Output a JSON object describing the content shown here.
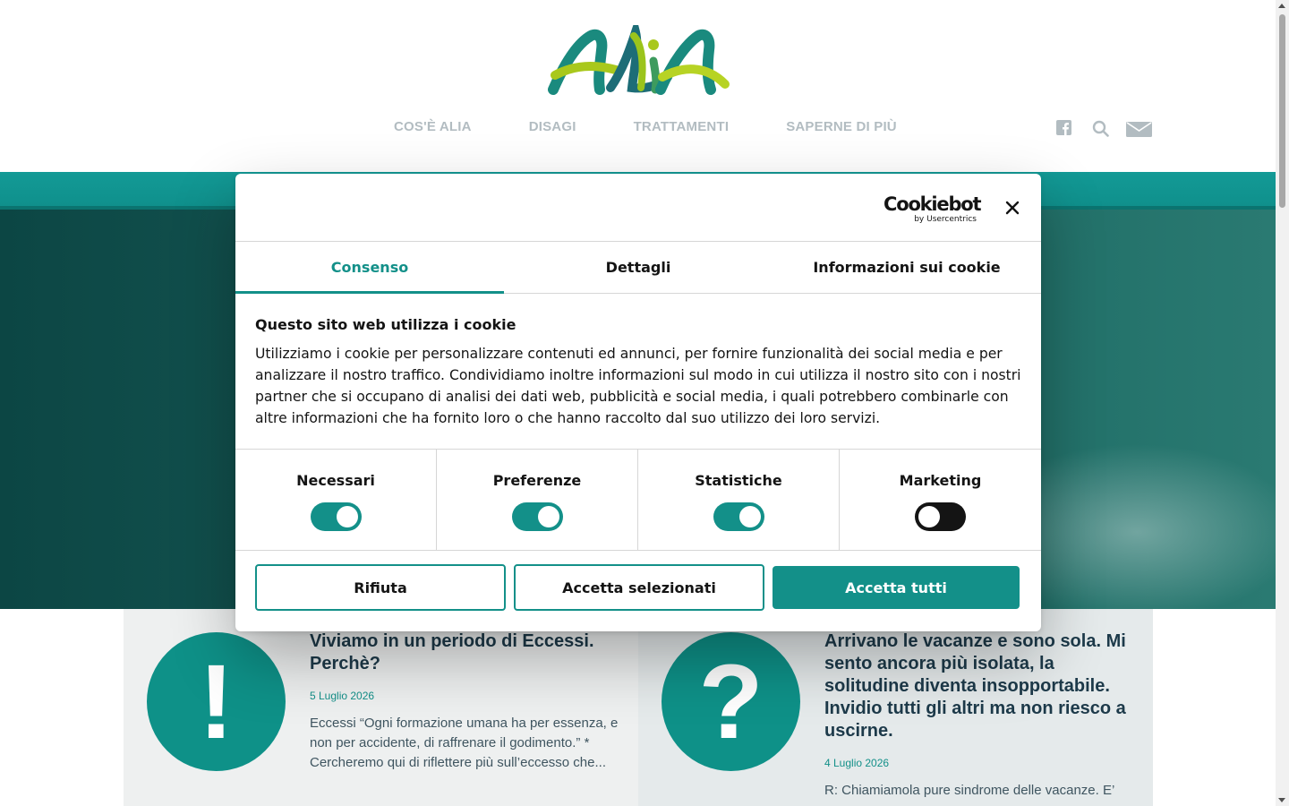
{
  "header": {
    "nav": [
      "COS'È ALIA",
      "DISAGI",
      "TRATTAMENTI",
      "SAPERNE DI PIÙ"
    ],
    "icons": [
      "facebook-icon",
      "search-icon",
      "mail-icon"
    ]
  },
  "colors": {
    "accent": "#139089",
    "nav_text": "#b2bcc1",
    "card_title": "#1d3a4a",
    "hero_dark": "#0c4644"
  },
  "cards": [
    {
      "icon_glyph": "!",
      "title": "Viviamo in un periodo di Eccessi. Perchè?",
      "date": "5 Luglio 2026",
      "excerpt": "Eccessi “Ogni formazione umana ha per essenza, e non per accidente, di raffrenare il godimento.” *\n  Cercheremo qui di riflettere più sull’eccesso che..."
    },
    {
      "icon_glyph": "?",
      "title": "Arrivano le vacanze e sono sola. Mi sento ancora più isolata, la solitudine diventa insopportabile. Invidio tutti gli altri ma non riesco a uscirne.",
      "date": "4 Luglio 2026",
      "excerpt": "R: Chiamiamola pure sindrome delle vacanze. E’"
    }
  ],
  "cookie_dialog": {
    "brand": "Cookiebot",
    "brand_sub": "by Usercentrics",
    "tabs": [
      "Consenso",
      "Dettagli",
      "Informazioni sui cookie"
    ],
    "active_tab": "Consenso",
    "heading": "Questo sito web utilizza i cookie",
    "text": "Utilizziamo i cookie per personalizzare contenuti ed annunci, per fornire funzionalità dei social media e per analizzare il nostro traffico. Condividiamo inoltre informazioni sul modo in cui utilizza il nostro sito con i nostri partner che si occupano di analisi dei dati web, pubblicità e social media, i quali potrebbero combinarle con altre informazioni che ha fornito loro o che hanno raccolto dal suo utilizzo dei loro servizi.",
    "categories": [
      {
        "label": "Necessari",
        "enabled": true
      },
      {
        "label": "Preferenze",
        "enabled": true
      },
      {
        "label": "Statistiche",
        "enabled": true
      },
      {
        "label": "Marketing",
        "enabled": false
      }
    ],
    "buttons": {
      "reject": "Rifiuta",
      "accept_selected": "Accetta selezionati",
      "accept_all": "Accetta tutti"
    }
  }
}
